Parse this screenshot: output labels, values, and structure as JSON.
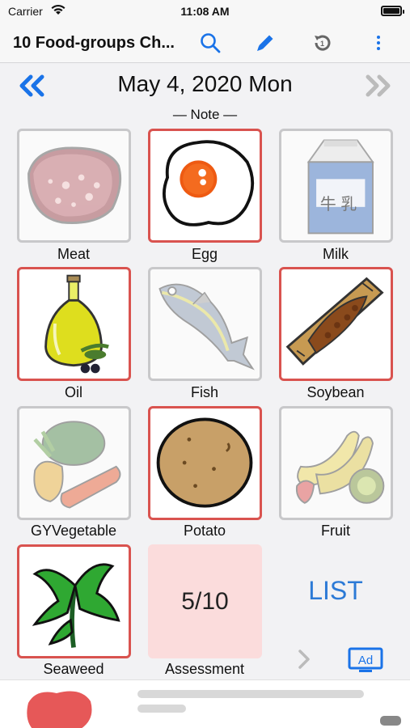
{
  "status": {
    "carrier": "Carrier",
    "time": "11:08 AM"
  },
  "nav": {
    "title": "10 Food-groups Ch..."
  },
  "icons": {
    "search": "search-icon",
    "edit": "pencil-icon",
    "history": "history-icon",
    "more": "more-vertical-icon",
    "prev": "double-chevron-left-icon",
    "next": "double-chevron-right-icon"
  },
  "colors": {
    "accent": "#1a73e8",
    "selected_border": "#d9534f",
    "assessment_bg": "#fbdcdc"
  },
  "date": {
    "text": "May 4, 2020 Mon"
  },
  "note": {
    "text": "— Note —"
  },
  "foods": [
    {
      "id": "meat",
      "label": "Meat",
      "selected": false
    },
    {
      "id": "egg",
      "label": "Egg",
      "selected": true
    },
    {
      "id": "milk",
      "label": "Milk",
      "selected": false
    },
    {
      "id": "oil",
      "label": "Oil",
      "selected": true
    },
    {
      "id": "fish",
      "label": "Fish",
      "selected": false
    },
    {
      "id": "soybean",
      "label": "Soybean",
      "selected": true
    },
    {
      "id": "gyvegetable",
      "label": "GYVegetable",
      "selected": false
    },
    {
      "id": "potato",
      "label": "Potato",
      "selected": true
    },
    {
      "id": "fruit",
      "label": "Fruit",
      "selected": false
    },
    {
      "id": "seaweed",
      "label": "Seaweed",
      "selected": true
    }
  ],
  "milk_carton_text": "牛 乳",
  "assessment": {
    "score": "5/10",
    "label": "Assessment"
  },
  "list": {
    "label": "LIST"
  },
  "ad": {
    "badge": "Ad"
  }
}
